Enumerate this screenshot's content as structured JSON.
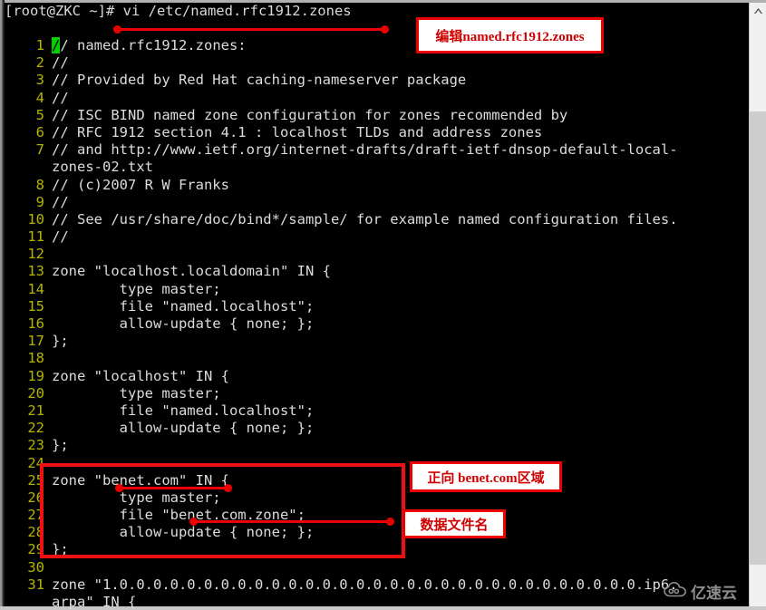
{
  "terminal": {
    "prompt": "[root@ZKC ~]# vi /etc/named.rfc1912.zones",
    "cursor_char": "/",
    "lines": [
      {
        "num": "1",
        "text": "// named.rfc1912.zones:",
        "cursor": true
      },
      {
        "num": "2",
        "text": "//"
      },
      {
        "num": "3",
        "text": "// Provided by Red Hat caching-nameserver package"
      },
      {
        "num": "4",
        "text": "//"
      },
      {
        "num": "5",
        "text": "// ISC BIND named zone configuration for zones recommended by"
      },
      {
        "num": "6",
        "text": "// RFC 1912 section 4.1 : localhost TLDs and address zones"
      },
      {
        "num": "7",
        "text": "// and http://www.ietf.org/internet-drafts/draft-ietf-dnsop-default-local-"
      },
      {
        "num": "",
        "text": "zones-02.txt",
        "wrap": true
      },
      {
        "num": "8",
        "text": "// (c)2007 R W Franks"
      },
      {
        "num": "9",
        "text": "//"
      },
      {
        "num": "10",
        "text": "// See /usr/share/doc/bind*/sample/ for example named configuration files."
      },
      {
        "num": "11",
        "text": "//"
      },
      {
        "num": "12",
        "text": ""
      },
      {
        "num": "13",
        "text": "zone \"localhost.localdomain\" IN {"
      },
      {
        "num": "14",
        "text": "        type master;"
      },
      {
        "num": "15",
        "text": "        file \"named.localhost\";"
      },
      {
        "num": "16",
        "text": "        allow-update { none; };"
      },
      {
        "num": "17",
        "text": "};"
      },
      {
        "num": "18",
        "text": ""
      },
      {
        "num": "19",
        "text": "zone \"localhost\" IN {"
      },
      {
        "num": "20",
        "text": "        type master;"
      },
      {
        "num": "21",
        "text": "        file \"named.localhost\";"
      },
      {
        "num": "22",
        "text": "        allow-update { none; };"
      },
      {
        "num": "23",
        "text": "};"
      },
      {
        "num": "24",
        "text": ""
      },
      {
        "num": "25",
        "text": "zone \"benet.com\" IN {"
      },
      {
        "num": "26",
        "text": "        type master;"
      },
      {
        "num": "27",
        "text": "        file \"benet.com.zone\";"
      },
      {
        "num": "28",
        "text": "        allow-update { none; };"
      },
      {
        "num": "29",
        "text": "};"
      },
      {
        "num": "30",
        "text": ""
      },
      {
        "num": "31",
        "text": "zone \"1.0.0.0.0.0.0.0.0.0.0.0.0.0.0.0.0.0.0.0.0.0.0.0.0.0.0.0.0.0.0.0.ip6."
      },
      {
        "num": "",
        "text": "arpa\" IN {",
        "wrap": true
      }
    ]
  },
  "annotations": {
    "top_label": "编辑named.rfc1912.zones",
    "zone_label": "正向 benet.com区域",
    "file_label": "数据文件名"
  },
  "watermark": {
    "text": "亿速云"
  },
  "colors": {
    "background": "#000000",
    "text": "#dcdcdc",
    "line_number": "#b5b500",
    "cursor": "#00d000",
    "annotation_red": "#ee0000",
    "annotation_bg": "#ffffff"
  }
}
